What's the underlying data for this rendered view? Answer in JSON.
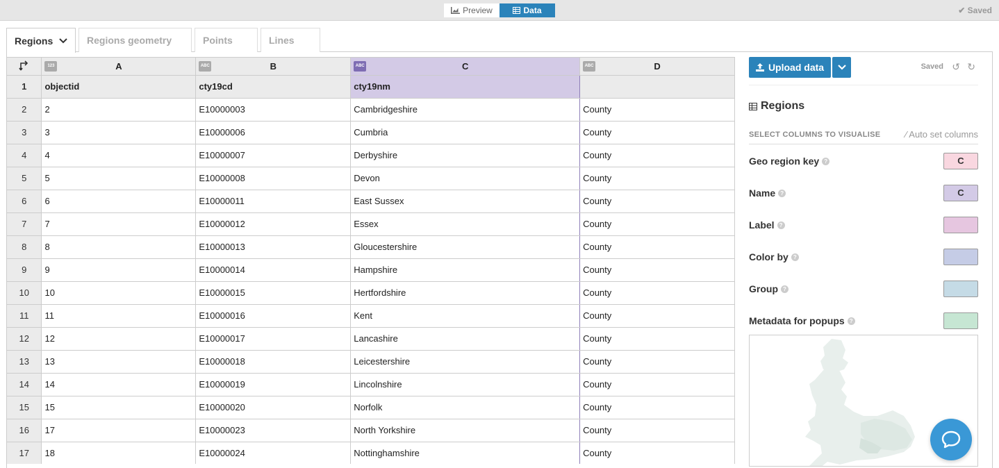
{
  "toggle": {
    "preview_label": "Preview",
    "data_label": "Data"
  },
  "top_status": "Saved",
  "tabs": [
    {
      "label": "Regions"
    },
    {
      "label": "Regions geometry"
    },
    {
      "label": "Points"
    },
    {
      "label": "Lines"
    }
  ],
  "grid": {
    "columns": [
      {
        "letter": "A",
        "type": "123"
      },
      {
        "letter": "B",
        "type": "ABC"
      },
      {
        "letter": "C",
        "type": "ABC"
      },
      {
        "letter": "D",
        "type": "ABC"
      }
    ],
    "rows": [
      [
        "1",
        "objectid",
        "cty19cd",
        "cty19nm",
        ""
      ],
      [
        "2",
        "2",
        "E10000003",
        "Cambridgeshire",
        "County"
      ],
      [
        "3",
        "3",
        "E10000006",
        "Cumbria",
        "County"
      ],
      [
        "4",
        "4",
        "E10000007",
        "Derbyshire",
        "County"
      ],
      [
        "5",
        "5",
        "E10000008",
        "Devon",
        "County"
      ],
      [
        "6",
        "6",
        "E10000011",
        "East Sussex",
        "County"
      ],
      [
        "7",
        "7",
        "E10000012",
        "Essex",
        "County"
      ],
      [
        "8",
        "8",
        "E10000013",
        "Gloucestershire",
        "County"
      ],
      [
        "9",
        "9",
        "E10000014",
        "Hampshire",
        "County"
      ],
      [
        "10",
        "10",
        "E10000015",
        "Hertfordshire",
        "County"
      ],
      [
        "11",
        "11",
        "E10000016",
        "Kent",
        "County"
      ],
      [
        "12",
        "12",
        "E10000017",
        "Lancashire",
        "County"
      ],
      [
        "13",
        "13",
        "E10000018",
        "Leicestershire",
        "County"
      ],
      [
        "14",
        "14",
        "E10000019",
        "Lincolnshire",
        "County"
      ],
      [
        "15",
        "15",
        "E10000020",
        "Norfolk",
        "County"
      ],
      [
        "16",
        "17",
        "E10000023",
        "North Yorkshire",
        "County"
      ],
      [
        "17",
        "18",
        "E10000024",
        "Nottinghamshire",
        "County"
      ]
    ]
  },
  "side": {
    "upload_label": "Upload data",
    "saved_label": "Saved",
    "title": "Regions",
    "select_heading": "SELECT COLUMNS TO VISUALISE",
    "auto_set_label": "Auto set columns",
    "bindings": [
      {
        "label": "Geo region key",
        "value": "C",
        "color": "#f9d7e0"
      },
      {
        "label": "Name",
        "value": "C",
        "color": "#d3cae6"
      },
      {
        "label": "Label",
        "value": "",
        "color": "#e6c6e0"
      },
      {
        "label": "Color by",
        "value": "",
        "color": "#c5cce6"
      },
      {
        "label": "Group",
        "value": "",
        "color": "#c5dbe6"
      },
      {
        "label": "Metadata for popups",
        "value": "",
        "color": "#c6e6d3"
      }
    ]
  },
  "icons": [
    "chart-icon",
    "table-icon",
    "chevron-down-icon",
    "check-icon",
    "upload-icon",
    "undo-icon",
    "redo-icon",
    "wand-icon",
    "help-icon",
    "chat-icon",
    "transpose-icon"
  ]
}
